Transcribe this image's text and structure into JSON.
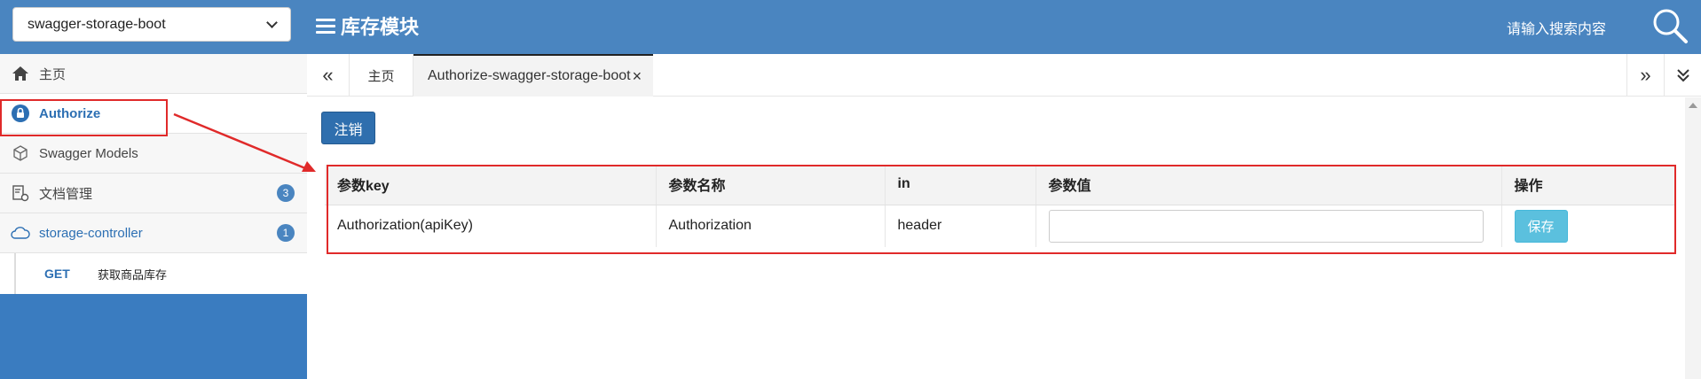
{
  "header": {
    "group_select": "swagger-storage-boot",
    "module_title": "库存模块",
    "search_placeholder": "请输入搜索内容"
  },
  "sidebar": {
    "items": [
      {
        "label": "主页",
        "icon": "home-icon"
      },
      {
        "label": "Authorize",
        "icon": "lock-icon"
      },
      {
        "label": "Swagger Models",
        "icon": "cube-icon"
      },
      {
        "label": "文档管理",
        "icon": "doc-settings-icon",
        "badge": "3"
      },
      {
        "label": "storage-controller",
        "icon": "cloud-icon",
        "badge": "1"
      }
    ],
    "sub_items": [
      {
        "method": "GET",
        "label": "获取商品库存"
      }
    ]
  },
  "tabs": {
    "home": "主页",
    "active": "Authorize-swagger-storage-boot",
    "close": "×",
    "prev": "«",
    "next": "»"
  },
  "content": {
    "logout_label": "注销",
    "table": {
      "headers": [
        "参数key",
        "参数名称",
        "in",
        "参数值",
        "操作"
      ],
      "rows": [
        {
          "key": "Authorization(apiKey)",
          "name": "Authorization",
          "in": "header",
          "value": "",
          "action": "保存"
        }
      ]
    }
  },
  "colors": {
    "header_bg": "#4a85c0",
    "sidebar_bg": "#3a7cc0",
    "primary_btn": "#2f6fae",
    "info_btn": "#5bc0de",
    "highlight": "#e02a2a"
  }
}
